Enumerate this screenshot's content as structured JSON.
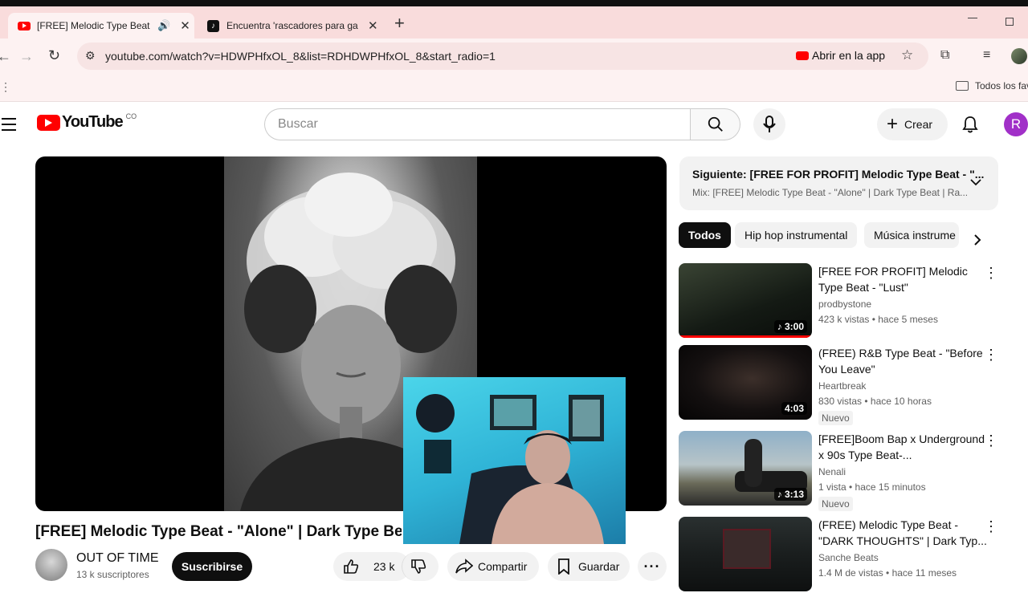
{
  "browser": {
    "tabs": [
      {
        "label": "[FREE] Melodic Type Beat -",
        "icon": "youtube-icon",
        "active": true
      },
      {
        "label": "Encuentra 'rascadores para gat",
        "icon": "tiktok-icon",
        "active": false
      }
    ],
    "new_tab": "+",
    "url": "youtube.com/watch?v=HDWPHfxOL_8&list=RDHDWPHfxOL_8&start_radio=1",
    "open_in_app": "Abrir en la app",
    "bookmarks_folder": "Todos los fav"
  },
  "youtube": {
    "logo_text": "YouTube",
    "country": "CO",
    "search_placeholder": "Buscar",
    "create_label": "Crear",
    "avatar_letter": "R",
    "video_title": "[FREE] Melodic Type Beat - \"Alone\" | Dark Type Beat",
    "channel_name": "OUT OF TIME",
    "subscribers": "13 k suscriptores",
    "subscribe_label": "Suscribirse",
    "likes": "23 k",
    "share_label": "Compartir",
    "save_label": "Guardar",
    "next_up": {
      "label": "Siguiente: [FREE FOR PROFIT] Melodic Type Beat - \"...",
      "mix": "Mix: [FREE] Melodic Type Beat - \"Alone\" | Dark Type Beat | Ra..."
    },
    "chips": [
      "Todos",
      "Hip hop instrumental",
      "Música instrume"
    ],
    "recommendations": [
      {
        "title": "[FREE FOR PROFIT] Melodic Type Beat - \"Lust\"",
        "channel": "prodbystone",
        "meta": "423 k vistas • hace 5 meses",
        "duration": "3:00",
        "badge": ""
      },
      {
        "title": "(FREE) R&B Type Beat - \"Before You Leave\"",
        "channel": "Heartbreak",
        "meta": "830 vistas • hace 10 horas",
        "duration": "4:03",
        "badge": "Nuevo"
      },
      {
        "title": "[FREE]Boom Bap x Underground x 90s Type Beat-...",
        "channel": "Nenali",
        "meta": "1 vista • hace 15 minutos",
        "duration": "3:13",
        "badge": "Nuevo"
      },
      {
        "title": "(FREE) Melodic Type Beat - \"DARK THOUGHTS\" | Dark Typ...",
        "channel": "Sanche Beats",
        "meta": "1.4 M de vistas • hace 11 meses",
        "duration": "",
        "badge": ""
      }
    ]
  },
  "colors": {
    "youtube_red": "#ff0000",
    "tab_strip": "#f9dcdc",
    "avatar": "#a130c8",
    "webcam": "#33c0dd"
  }
}
